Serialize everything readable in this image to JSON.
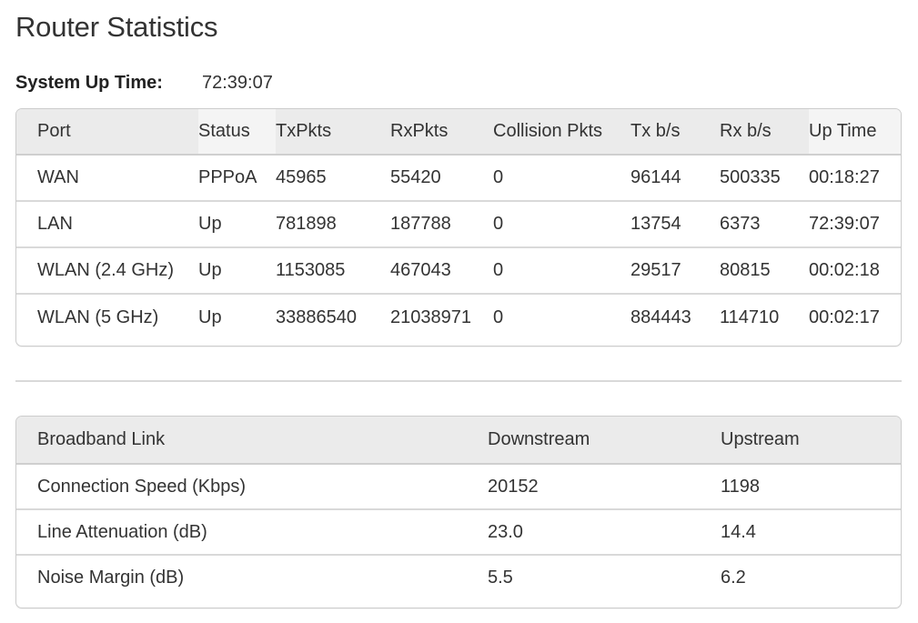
{
  "page": {
    "title": "Router Statistics"
  },
  "system": {
    "uptime_label": "System Up Time:",
    "uptime_value": "72:39:07"
  },
  "stats": {
    "headers": [
      "Port",
      "Status",
      "TxPkts",
      "RxPkts",
      "Collision Pkts",
      "Tx b/s",
      "Rx b/s",
      "Up Time"
    ],
    "rows": [
      [
        "WAN",
        "PPPoA",
        "45965",
        "55420",
        "0",
        "96144",
        "500335",
        "00:18:27"
      ],
      [
        "LAN",
        "Up",
        "781898",
        "187788",
        "0",
        "13754",
        "6373",
        "72:39:07"
      ],
      [
        "WLAN (2.4 GHz)",
        "Up",
        "1153085",
        "467043",
        "0",
        "29517",
        "80815",
        "00:02:18"
      ],
      [
        "WLAN (5 GHz)",
        "Up",
        "33886540",
        "21038971",
        "0",
        "884443",
        "114710",
        "00:02:17"
      ]
    ]
  },
  "broadband": {
    "headers": [
      "Broadband Link",
      "Downstream",
      "Upstream"
    ],
    "rows": [
      [
        "Connection Speed (Kbps)",
        "20152",
        "1198"
      ],
      [
        "Line Attenuation (dB)",
        "23.0",
        "14.4"
      ],
      [
        "Noise Margin (dB)",
        "5.5",
        "6.2"
      ]
    ]
  },
  "colors": {
    "header_bg": "#ebebeb",
    "header_alt_bg": "#f4f4f4",
    "border": "#cccccc",
    "row_divider": "#d9d9d9",
    "text": "#333333"
  }
}
